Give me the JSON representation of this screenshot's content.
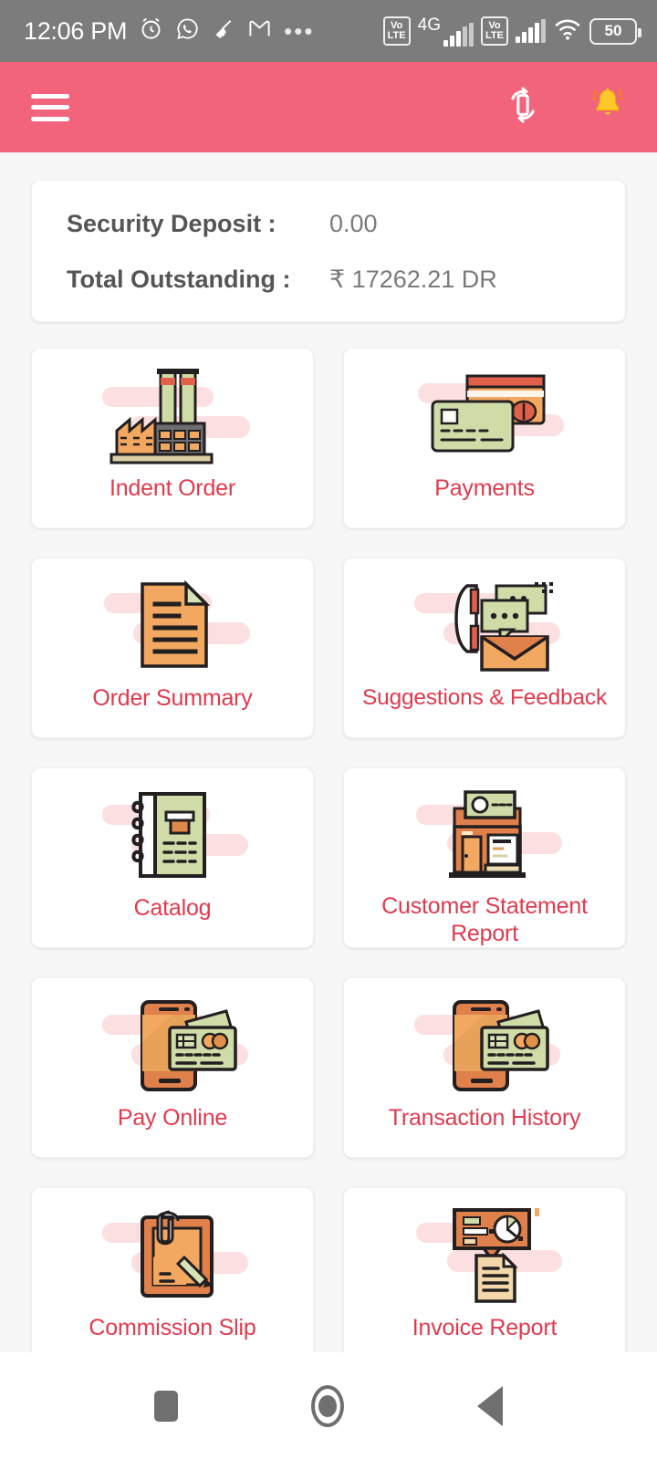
{
  "status_bar": {
    "time": "12:06 PM",
    "left_icons": [
      "alarm-icon",
      "whatsapp-icon",
      "broom-icon",
      "gmail-icon",
      "more-dots-icon"
    ],
    "more_dots": "•••",
    "volte_line1": "Vo",
    "volte_line2": "LTE",
    "network_label": "4G",
    "battery_level": "50"
  },
  "app_bar": {
    "menu_label": "Menu",
    "rotate_icon": "rotate-device-icon",
    "notification_icon": "notification-bell-icon",
    "background_color": "#f2647c"
  },
  "summary": {
    "rows": [
      {
        "label": "Security Deposit :",
        "value": "0.00"
      },
      {
        "label": "Total Outstanding :",
        "value": "₹ 17262.21  DR"
      }
    ]
  },
  "menu_grid": {
    "accent_color": "#e03a4d",
    "tiles": [
      {
        "label": "Indent Order",
        "icon": "factory-icon"
      },
      {
        "label": "Payments",
        "icon": "credit-cards-icon"
      },
      {
        "label": "Order Summary",
        "icon": "document-icon"
      },
      {
        "label": "Suggestions & Feedback",
        "icon": "phone-chat-mail-icon"
      },
      {
        "label": "Catalog",
        "icon": "notebook-icon"
      },
      {
        "label": "Customer Statement Report",
        "icon": "storefront-icon"
      },
      {
        "label": "Pay Online",
        "icon": "phone-card-icon"
      },
      {
        "label": "Transaction History",
        "icon": "phone-card-icon"
      },
      {
        "label": "Commission Slip",
        "icon": "clipboard-pen-icon"
      },
      {
        "label": "Invoice Report",
        "icon": "chart-document-icon"
      }
    ]
  },
  "nav_bar": {
    "recents_label": "Recents",
    "home_label": "Home",
    "back_label": "Back"
  }
}
